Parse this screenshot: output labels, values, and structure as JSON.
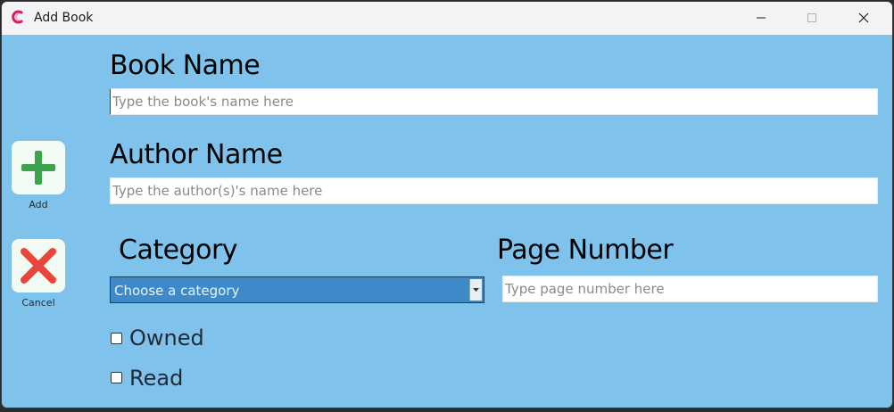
{
  "window": {
    "title": "Add Book"
  },
  "sidebar": {
    "add_label": "Add",
    "cancel_label": "Cancel"
  },
  "form": {
    "book_name_label": "Book Name",
    "book_name_placeholder": "Type the book's name here",
    "author_name_label": "Author Name",
    "author_name_placeholder": "Type the author(s)'s name here",
    "category_label": "Category",
    "category_value": "Choose a category",
    "page_number_label": "Page Number",
    "page_number_placeholder": "Type page number here",
    "owned_label": "Owned",
    "read_label": "Read"
  },
  "colors": {
    "background": "#7fc3ec",
    "select_bg": "#3e8ac8",
    "add_icon": "#3fa34d",
    "cancel_icon": "#e8453c",
    "app_icon": "#d81b60"
  }
}
